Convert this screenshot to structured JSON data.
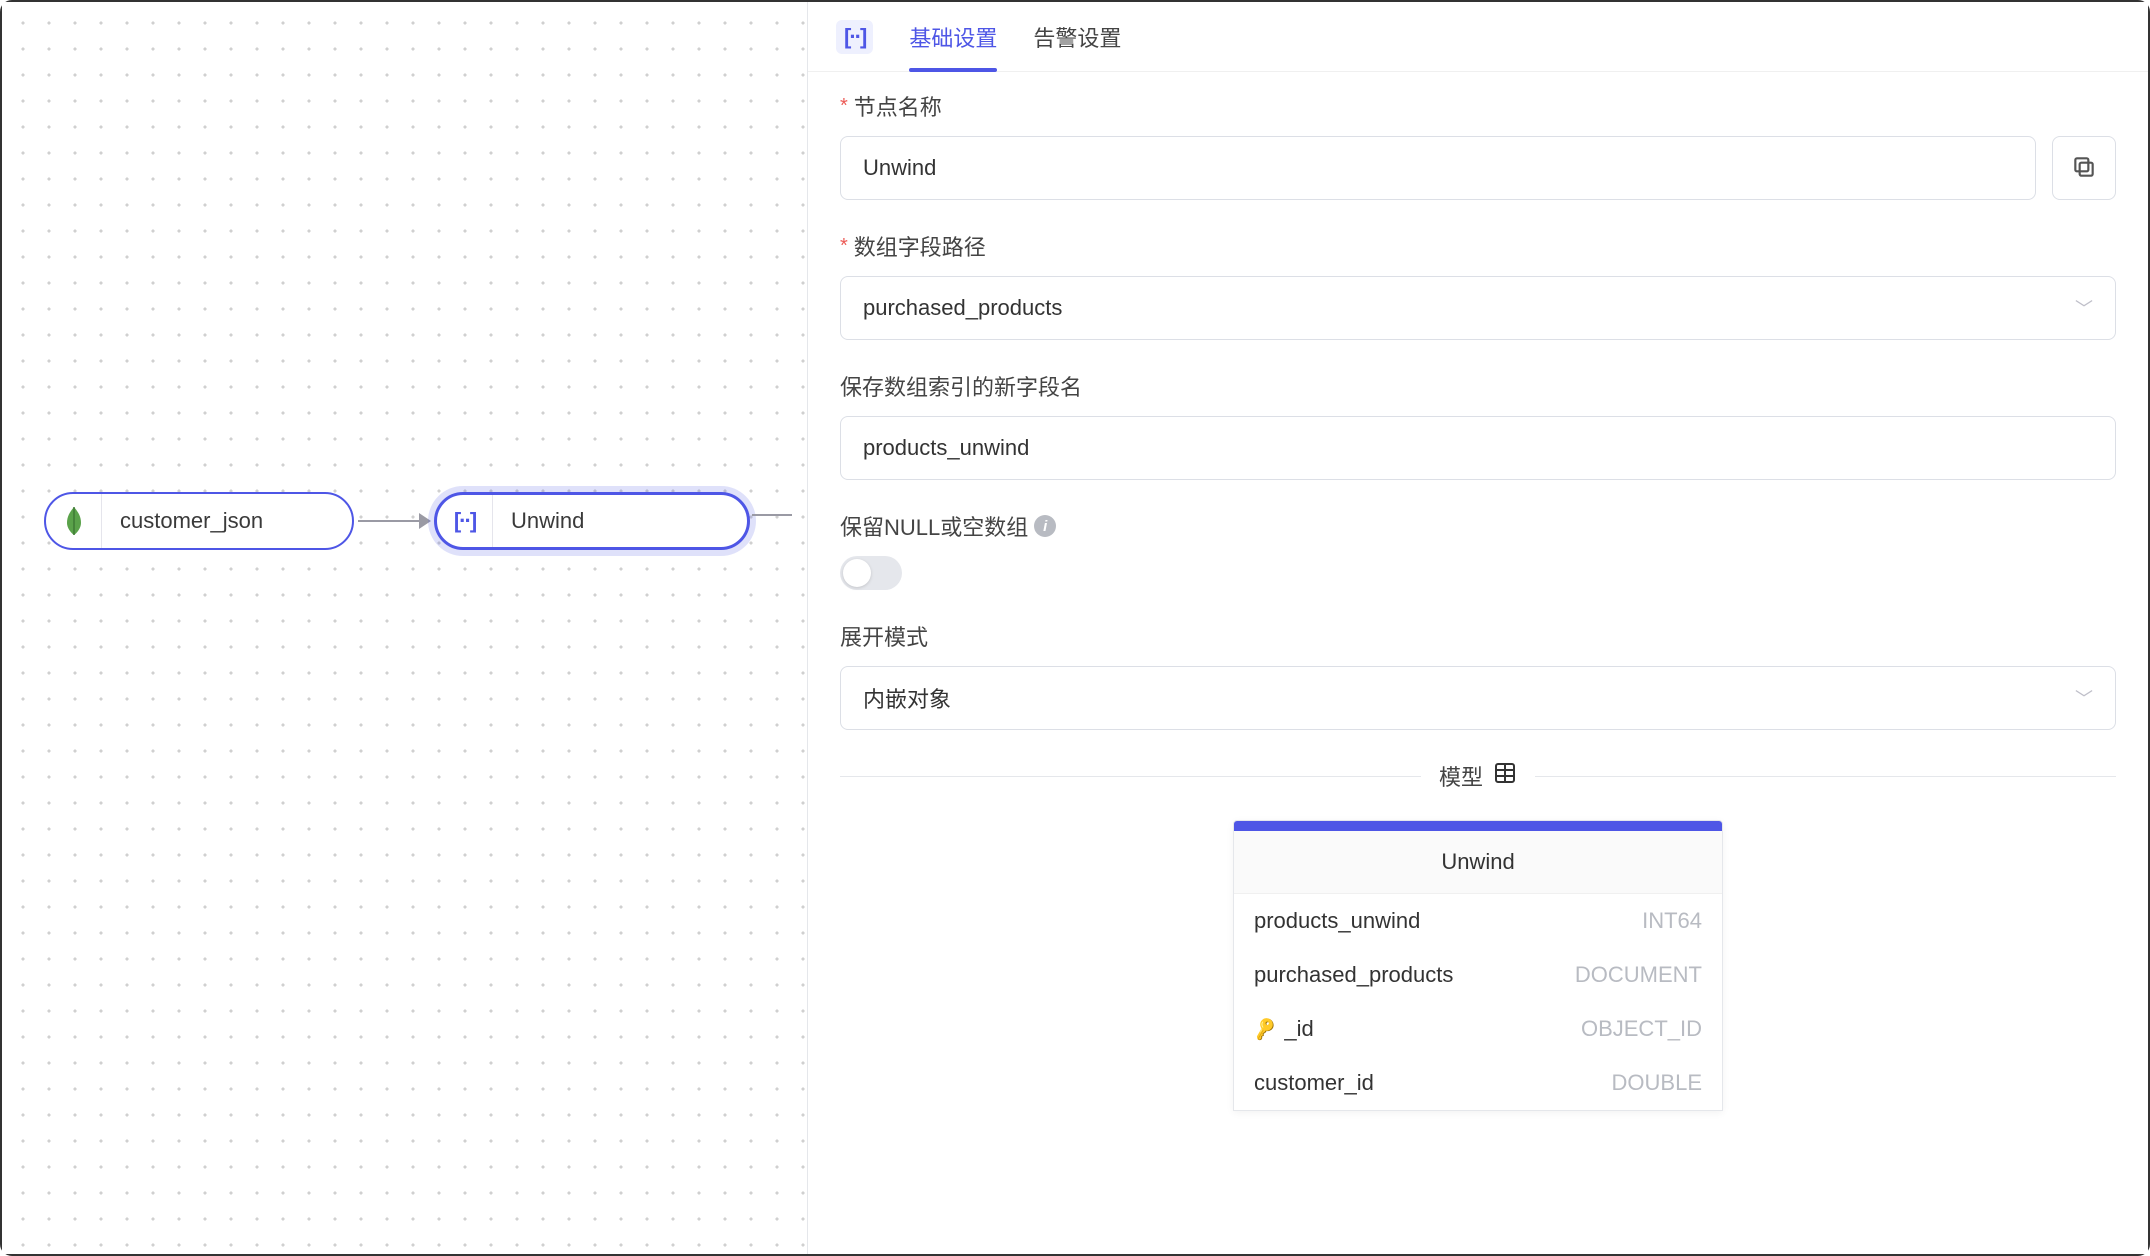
{
  "canvas": {
    "node1": {
      "label": "customer_json",
      "icon": "mongodb-icon"
    },
    "node2": {
      "label": "Unwind",
      "icon": "unwind-icon",
      "icon_text": "[··]"
    }
  },
  "tabs": {
    "icon_text": "[··]",
    "tab_basic": "基础设置",
    "tab_alert": "告警设置"
  },
  "form": {
    "node_name": {
      "label": "节点名称",
      "value": "Unwind"
    },
    "array_path": {
      "label": "数组字段路径",
      "value": "purchased_products"
    },
    "index_field": {
      "label": "保存数组索引的新字段名",
      "value": "products_unwind"
    },
    "preserve_null": {
      "label": "保留NULL或空数组"
    },
    "expand_mode": {
      "label": "展开模式",
      "value": "内嵌对象"
    }
  },
  "model": {
    "divider_label": "模型",
    "title": "Unwind",
    "rows": [
      {
        "name": "products_unwind",
        "type": "INT64",
        "is_key": false
      },
      {
        "name": "purchased_products",
        "type": "DOCUMENT",
        "is_key": false
      },
      {
        "name": "_id",
        "type": "OBJECT_ID",
        "is_key": true
      },
      {
        "name": "customer_id",
        "type": "DOUBLE",
        "is_key": false
      }
    ]
  }
}
